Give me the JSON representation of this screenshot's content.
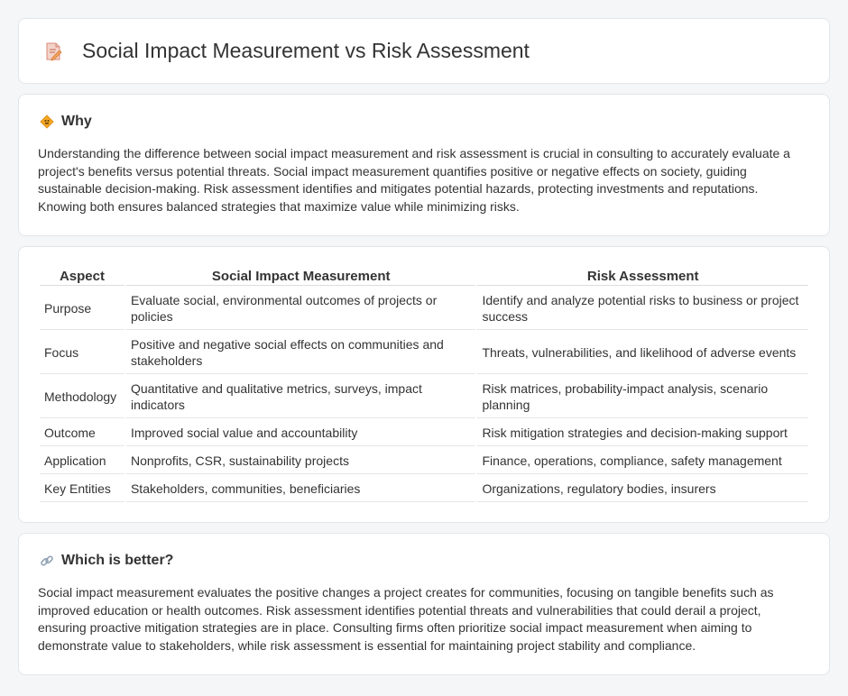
{
  "header": {
    "title": "Social Impact Measurement vs Risk Assessment",
    "icon": "document-pen-icon"
  },
  "why": {
    "title": "Why",
    "icon": "diamond-sign-icon",
    "text": "Understanding the difference between social impact measurement and risk assessment is crucial in consulting to accurately evaluate a project's benefits versus potential threats. Social impact measurement quantifies positive or negative effects on society, guiding sustainable decision-making. Risk assessment identifies and mitigates potential hazards, protecting investments and reputations. Knowing both ensures balanced strategies that maximize value while minimizing risks."
  },
  "table": {
    "headers": [
      "Aspect",
      "Social Impact Measurement",
      "Risk Assessment"
    ],
    "rows": [
      [
        "Purpose",
        "Evaluate social, environmental outcomes of projects or policies",
        "Identify and analyze potential risks to business or project success"
      ],
      [
        "Focus",
        "Positive and negative social effects on communities and stakeholders",
        "Threats, vulnerabilities, and likelihood of adverse events"
      ],
      [
        "Methodology",
        "Quantitative and qualitative metrics, surveys, impact indicators",
        "Risk matrices, probability-impact analysis, scenario planning"
      ],
      [
        "Outcome",
        "Improved social value and accountability",
        "Risk mitigation strategies and decision-making support"
      ],
      [
        "Application",
        "Nonprofits, CSR, sustainability projects",
        "Finance, operations, compliance, safety management"
      ],
      [
        "Key Entities",
        "Stakeholders, communities, beneficiaries",
        "Organizations, regulatory bodies, insurers"
      ]
    ]
  },
  "better": {
    "title": "Which is better?",
    "icon": "link-icon",
    "text": "Social impact measurement evaluates the positive changes a project creates for communities, focusing on tangible benefits such as improved education or health outcomes. Risk assessment identifies potential threats and vulnerabilities that could derail a project, ensuring proactive mitigation strategies are in place. Consulting firms often prioritize social impact measurement when aiming to demonstrate value to stakeholders, while risk assessment is essential for maintaining project stability and compliance."
  }
}
